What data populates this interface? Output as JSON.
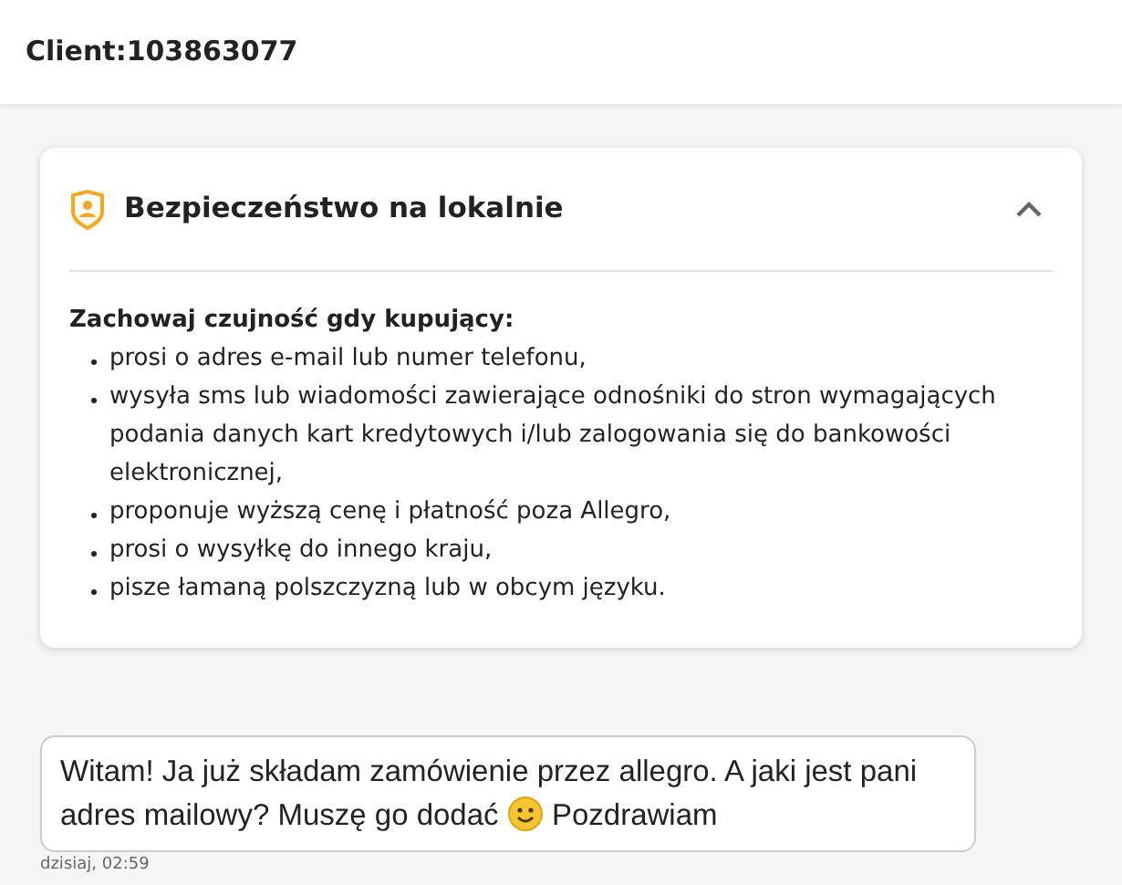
{
  "header": {
    "title": "Client:103863077"
  },
  "safety_card": {
    "title": "Bezpieczeństwo na lokalnie",
    "expanded": true,
    "intro": "Zachowaj czujność gdy kupujący:",
    "items": [
      "prosi o adres e-mail lub numer telefonu,",
      "wysyła sms lub wiadomości zawierające odnośniki do stron wymagających podania danych kart kredytowych i/lub zalogowania się do bankowości elektronicznej,",
      "proponuje wyższą cenę i płatność poza Allegro,",
      "prosi o wysyłkę do innego kraju,",
      "pisze łamaną polszczyzną lub w obcym języku."
    ]
  },
  "message": {
    "line_1": "Witam! Ja już składam zamówienie przez allegro. A jaki jest pani",
    "text_before": "adres mailowy? Muszę go dodać",
    "text_after": "Pozdrawiam",
    "time": "dzisiaj, 02:59"
  }
}
